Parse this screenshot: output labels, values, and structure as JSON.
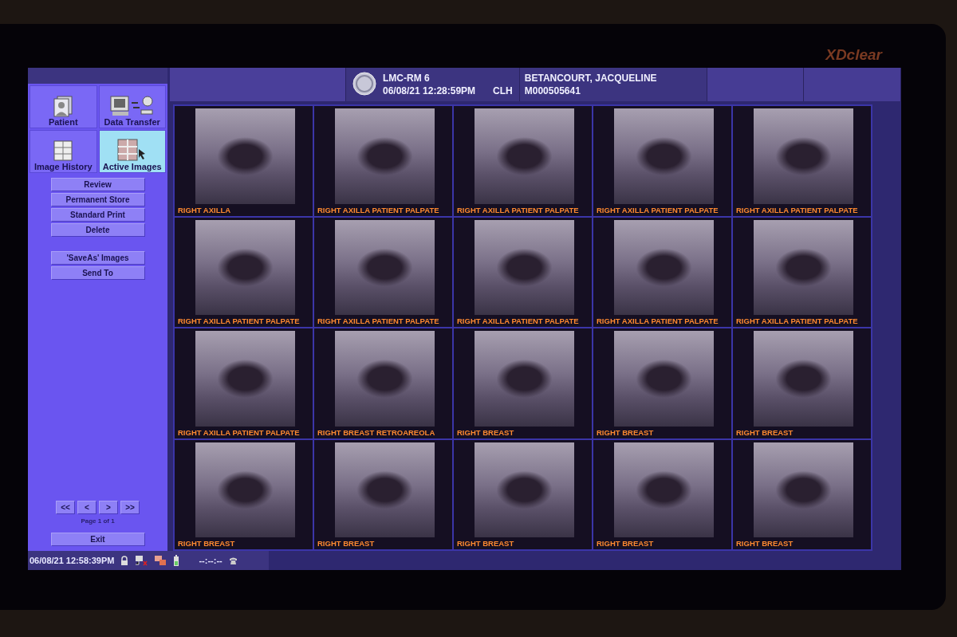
{
  "brand": "XDclear",
  "sidebar": {
    "tabs": [
      {
        "label": "Patient",
        "selected": false
      },
      {
        "label": "Data Transfer",
        "selected": false
      },
      {
        "label": "Image History",
        "selected": false
      },
      {
        "label": "Active Images",
        "selected": true
      }
    ],
    "buttons": [
      "Review",
      "Permanent Store",
      "Standard Print",
      "Delete"
    ],
    "buttons_2": [
      "'SaveAs' Images",
      "Send To"
    ],
    "pager": {
      "buttons": [
        "<<",
        "<",
        ">",
        ">>"
      ],
      "label": "Page 1 of 1"
    },
    "exit": "Exit"
  },
  "header": {
    "station": "LMC-RM 6",
    "datetime": "06/08/21 12:28:59PM",
    "operator": "CLH",
    "patient_name": "BETANCOURT, JACQUELINE",
    "patient_id": "M000505641"
  },
  "images": [
    {
      "label": "RIGHT AXILLA"
    },
    {
      "label": "RIGHT AXILLA PATIENT PALPATE"
    },
    {
      "label": "RIGHT AXILLA PATIENT PALPATE"
    },
    {
      "label": "RIGHT AXILLA PATIENT PALPATE"
    },
    {
      "label": "RIGHT AXILLA PATIENT PALPATE"
    },
    {
      "label": "RIGHT AXILLA PATIENT PALPATE"
    },
    {
      "label": "RIGHT AXILLA PATIENT PALPATE"
    },
    {
      "label": "RIGHT AXILLA PATIENT PALPATE"
    },
    {
      "label": "RIGHT AXILLA PATIENT PALPATE"
    },
    {
      "label": "RIGHT AXILLA PATIENT PALPATE"
    },
    {
      "label": "RIGHT AXILLA PATIENT PALPATE"
    },
    {
      "label": "RIGHT BREAST RETROAREOLA"
    },
    {
      "label": "RIGHT BREAST"
    },
    {
      "label": "RIGHT BREAST"
    },
    {
      "label": "RIGHT BREAST"
    },
    {
      "label": "RIGHT BREAST"
    },
    {
      "label": "RIGHT BREAST"
    },
    {
      "label": "RIGHT BREAST"
    },
    {
      "label": "RIGHT BREAST"
    },
    {
      "label": "RIGHT BREAST"
    }
  ],
  "status_bar": {
    "datetime": "06/08/21 12:58:39PM",
    "timer": "--:--:--"
  }
}
